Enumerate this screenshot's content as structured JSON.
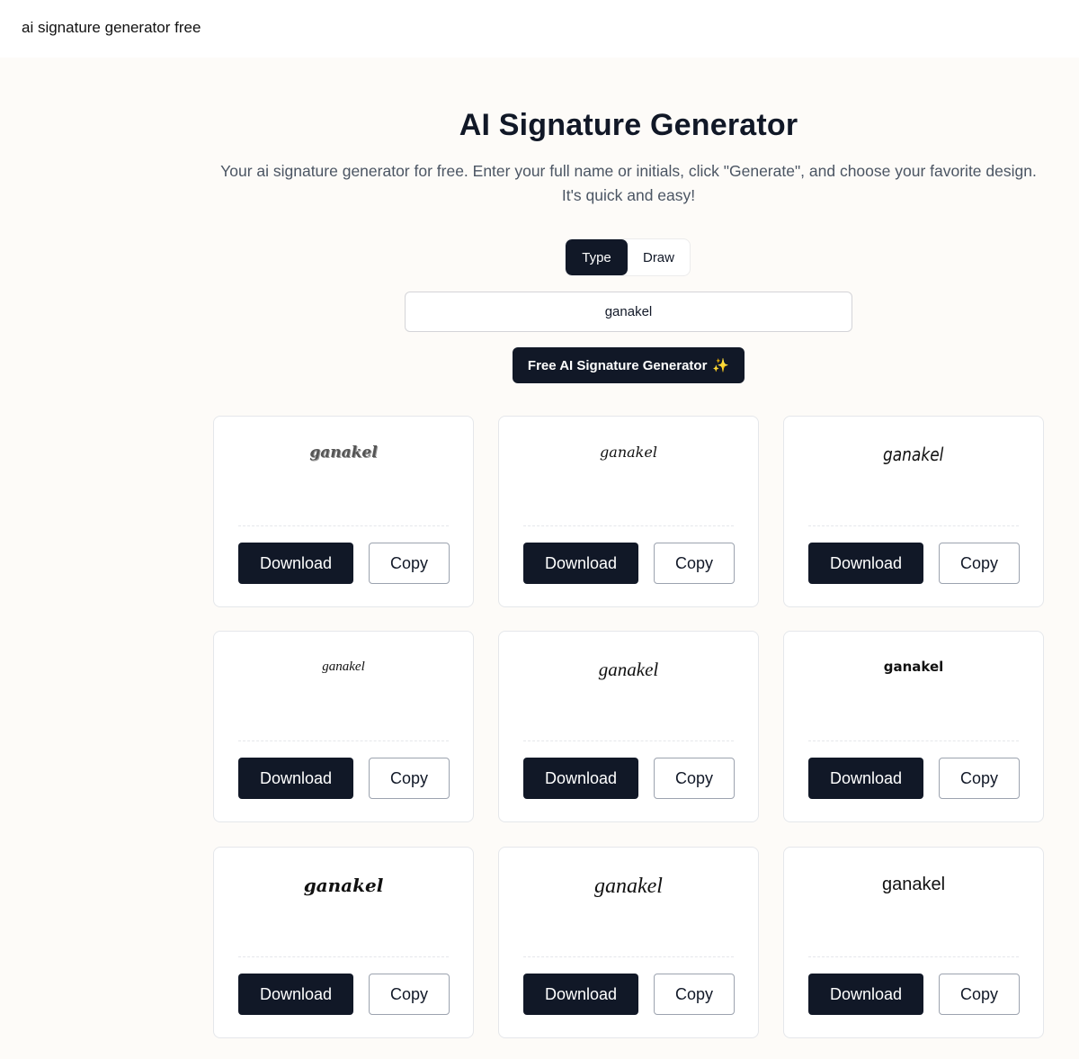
{
  "header": {
    "title": "ai signature generator free"
  },
  "hero": {
    "title": "AI Signature Generator",
    "description_line1": "Your ai signature generator for free. Enter your full name or initials, click \"Generate\", and choose your favorite design.",
    "description_line2": "It's quick and easy!"
  },
  "mode_toggle": {
    "type_label": "Type",
    "draw_label": "Draw",
    "active": "Type"
  },
  "name_input": {
    "value": "ganakel",
    "placeholder": ""
  },
  "generate_button": {
    "label": "Free AI Signature Generator",
    "icon": "sparkles-icon",
    "icon_glyph": "✨"
  },
  "cards": [
    {
      "signature": "ganakel",
      "download_label": "Download",
      "copy_label": "Copy"
    },
    {
      "signature": "ganakel",
      "download_label": "Download",
      "copy_label": "Copy"
    },
    {
      "signature": "ganakel",
      "download_label": "Download",
      "copy_label": "Copy"
    },
    {
      "signature": "ganakel",
      "download_label": "Download",
      "copy_label": "Copy"
    },
    {
      "signature": "ganakel",
      "download_label": "Download",
      "copy_label": "Copy"
    },
    {
      "signature": "ganakel",
      "download_label": "Download",
      "copy_label": "Copy"
    },
    {
      "signature": "ganakel",
      "download_label": "Download",
      "copy_label": "Copy"
    },
    {
      "signature": "ganakel",
      "download_label": "Download",
      "copy_label": "Copy"
    },
    {
      "signature": "ganakel",
      "download_label": "Download",
      "copy_label": "Copy"
    }
  ],
  "colors": {
    "primary": "#111827",
    "background": "#fdfbf8",
    "card_border": "#e5e7eb",
    "sparkle": "#fbbf24"
  }
}
